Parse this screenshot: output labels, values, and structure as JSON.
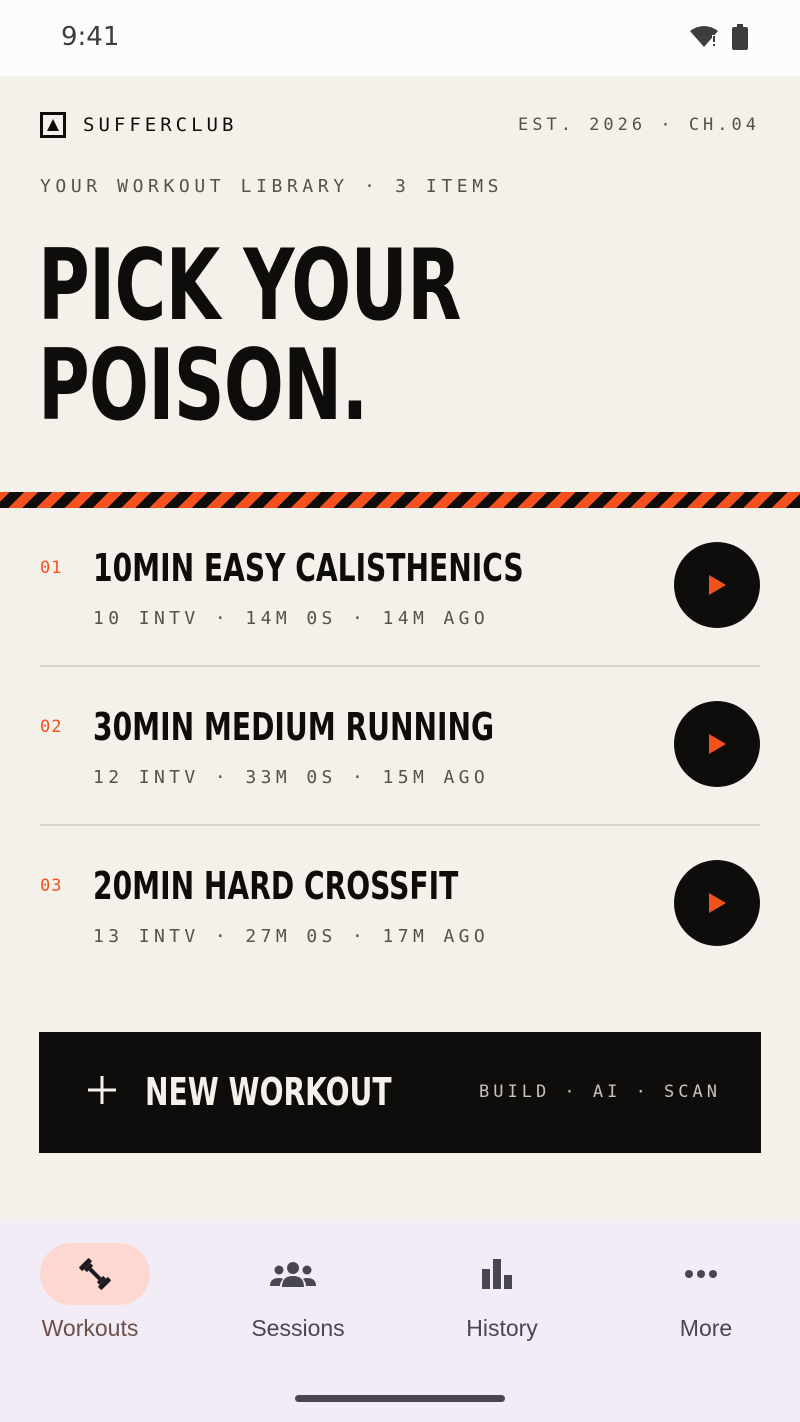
{
  "status_bar": {
    "time": "9:41"
  },
  "brand": {
    "name": "SUFFERCLUB",
    "edition": "EST. 2026 · CH.04"
  },
  "library": {
    "subtitle": "YOUR WORKOUT LIBRARY · 3 ITEMS"
  },
  "headline": {
    "line1": "PICK YOUR",
    "line2": "POISON."
  },
  "workouts": [
    {
      "num": "01",
      "title": "10MIN EASY CALISTHENICS",
      "meta": "10 INTV · 14M 0S · 14M AGO"
    },
    {
      "num": "02",
      "title": "30MIN MEDIUM RUNNING",
      "meta": "12 INTV · 33M 0S · 15M AGO"
    },
    {
      "num": "03",
      "title": "20MIN HARD CROSSFIT",
      "meta": "13 INTV · 27M 0S · 17M AGO"
    }
  ],
  "new_workout": {
    "label": "NEW WORKOUT",
    "sub": "BUILD · AI · SCAN"
  },
  "nav": {
    "items": [
      {
        "label": "Workouts",
        "icon": "dumbbell-icon",
        "active": true
      },
      {
        "label": "Sessions",
        "icon": "group-icon",
        "active": false
      },
      {
        "label": "History",
        "icon": "bar-chart-icon",
        "active": false
      },
      {
        "label": "More",
        "icon": "more-horizontal-icon",
        "active": false
      }
    ]
  },
  "colors": {
    "accent": "#f4511e",
    "ink": "#0f0d0b",
    "paper": "#f4f1ea",
    "nav_bg": "#f2ecf6",
    "active_pill": "#fdd8d1"
  }
}
